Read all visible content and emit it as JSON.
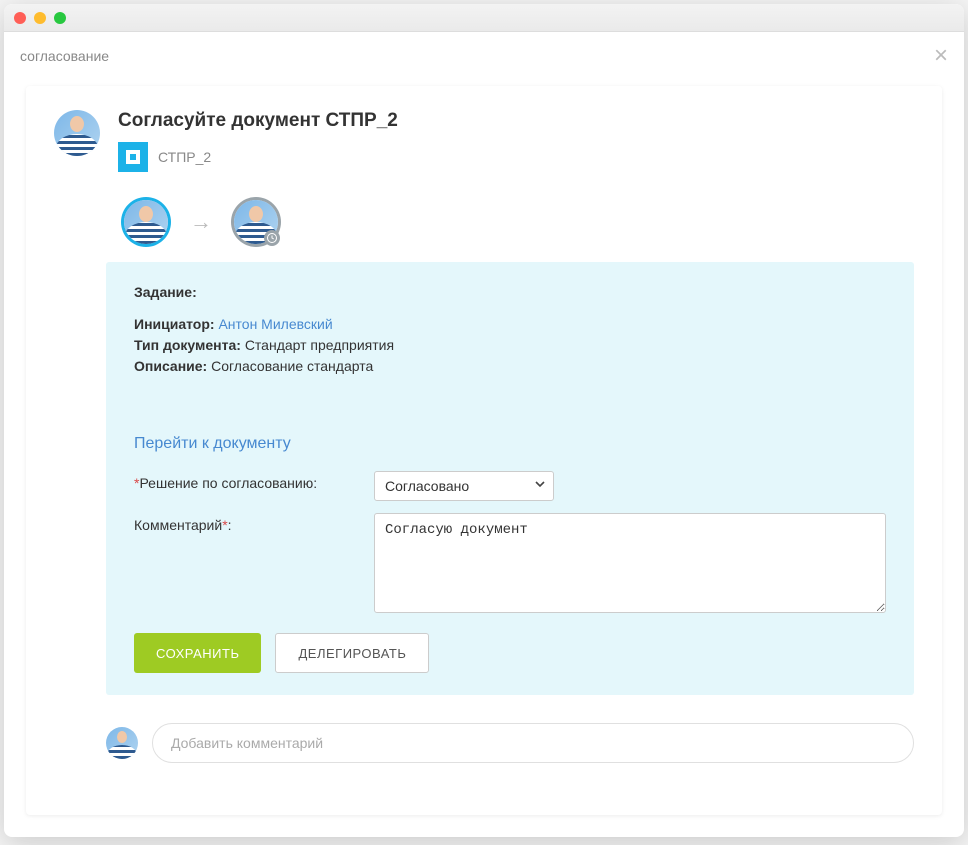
{
  "window": {
    "subtitle": "согласование"
  },
  "header": {
    "title": "Согласуйте документ СТПР_2",
    "doc_name": "СТПР_2"
  },
  "task": {
    "section_label": "Задание:",
    "initiator_label": "Инициатор:",
    "initiator_name": "Антон Милевский",
    "doctype_label": "Тип документа:",
    "doctype_value": "Стандарт предприятия",
    "description_label": "Описание:",
    "description_value": "Согласование стандарта",
    "goto_link": "Перейти к документу"
  },
  "form": {
    "decision_label": "Решение по согласованию:",
    "decision_value": "Согласовано",
    "comment_label": "Комментарий",
    "comment_value": "Согласую документ"
  },
  "actions": {
    "save": "СОХРАНИТЬ",
    "delegate": "ДЕЛЕГИРОВАТЬ"
  },
  "comments": {
    "placeholder": "Добавить комментарий"
  }
}
